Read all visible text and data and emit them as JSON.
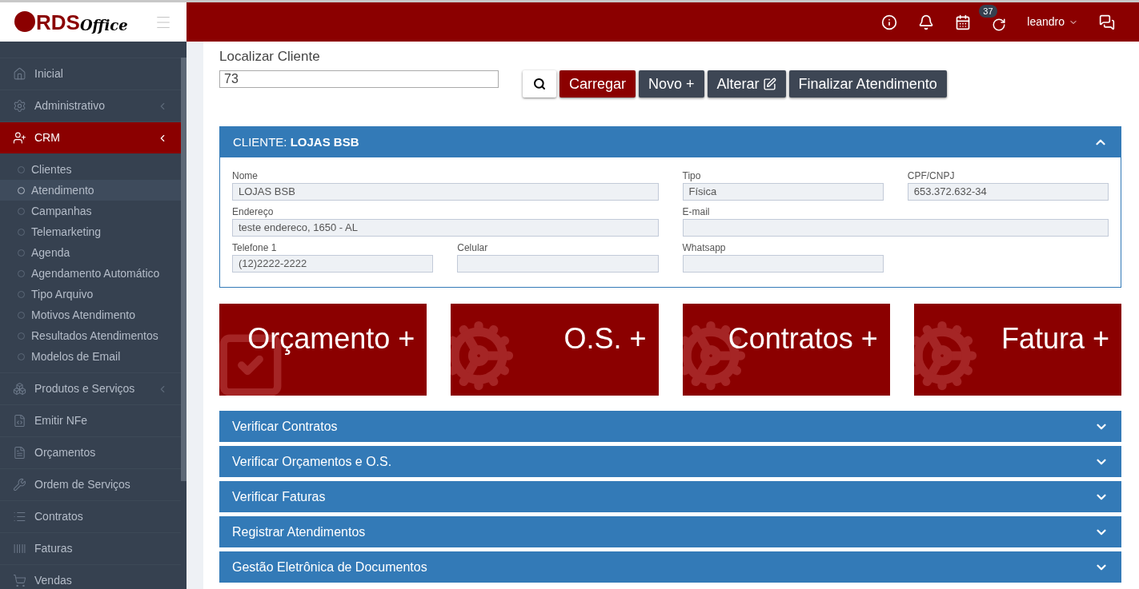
{
  "logo": {
    "brand": "RDS",
    "suffix": "Office"
  },
  "topbar": {
    "badge": "37",
    "user": "leandro"
  },
  "sidebar": {
    "items": [
      {
        "label": "Inicial",
        "kind": "home",
        "expanded": false,
        "has_children": false
      },
      {
        "label": "Administrativo",
        "kind": "gear",
        "expanded": false,
        "has_children": true
      },
      {
        "label": "CRM",
        "kind": "user-plus",
        "expanded": true,
        "has_children": true,
        "children": [
          {
            "label": "Clientes",
            "selected": false
          },
          {
            "label": "Atendimento",
            "selected": true
          },
          {
            "label": "Campanhas",
            "selected": false
          },
          {
            "label": "Telemarketing",
            "selected": false
          },
          {
            "label": "Agenda",
            "selected": false
          },
          {
            "label": "Agendamento Automático",
            "selected": false
          },
          {
            "label": "Tipo Arquivo",
            "selected": false
          },
          {
            "label": "Motivos Atendimento",
            "selected": false
          },
          {
            "label": "Resultados Atendimentos",
            "selected": false
          },
          {
            "label": "Modelos de Email",
            "selected": false
          }
        ]
      },
      {
        "label": "Produtos e Serviços",
        "kind": "cubes",
        "expanded": false,
        "has_children": true
      },
      {
        "label": "Emitir NFe",
        "kind": "file-code",
        "expanded": false,
        "has_children": false
      },
      {
        "label": "Orçamentos",
        "kind": "file",
        "expanded": false,
        "has_children": false
      },
      {
        "label": "Ordem de Serviços",
        "kind": "wrench",
        "expanded": false,
        "has_children": false
      },
      {
        "label": "Contratos",
        "kind": "list",
        "expanded": false,
        "has_children": false
      },
      {
        "label": "Faturas",
        "kind": "barcode",
        "expanded": false,
        "has_children": false
      },
      {
        "label": "Vendas",
        "kind": "cart",
        "expanded": false,
        "has_children": false
      }
    ]
  },
  "search": {
    "label": "Localizar Cliente",
    "value": "73"
  },
  "buttons": [
    {
      "label": "Carregar",
      "kind": "primary"
    },
    {
      "label": "Novo +",
      "kind": "dark"
    },
    {
      "label": "Alterar",
      "kind": "edit"
    },
    {
      "label": "Finalizar Atendimento",
      "kind": "dark"
    }
  ],
  "client_panel": {
    "title": "CLIENTE: **LOJAS BSB**",
    "expanded": true,
    "fields": [
      {
        "label": "Nome",
        "value": "LOJAS BSB",
        "wide": true
      },
      {
        "label": "Tipo",
        "value": "Física",
        "wide": false
      },
      {
        "label": "CPF/CNPJ",
        "value": "653.372.632-34",
        "wide": false
      },
      {
        "label": "Endereço",
        "value": "teste endereco, 1650 - AL",
        "wide": true
      },
      {
        "label": "E-mail",
        "wide": true
      },
      {
        "label": "Telefone 1",
        "value": "(12)2222-2222",
        "wide": false
      },
      {
        "label": "Celular",
        "wide": false
      },
      {
        "label": "Whatsapp",
        "wide": false
      }
    ]
  },
  "tiles": [
    {
      "label": "Orçamento +",
      "kind": "check"
    },
    {
      "label": "O.S. +",
      "kind": "gear"
    },
    {
      "label": "Contratos +",
      "kind": "gear"
    },
    {
      "label": "Fatura +",
      "kind": "gear"
    }
  ],
  "sections": [
    {
      "title": "Verificar Contratos",
      "expanded": false
    },
    {
      "title": "Verificar Orçamentos e O.S.",
      "expanded": false
    },
    {
      "title": "Verificar Faturas",
      "expanded": false
    },
    {
      "title": "Registrar Atendimentos",
      "expanded": false
    },
    {
      "title": "Gestão Eletrônica de Documentos",
      "expanded": false
    }
  ]
}
